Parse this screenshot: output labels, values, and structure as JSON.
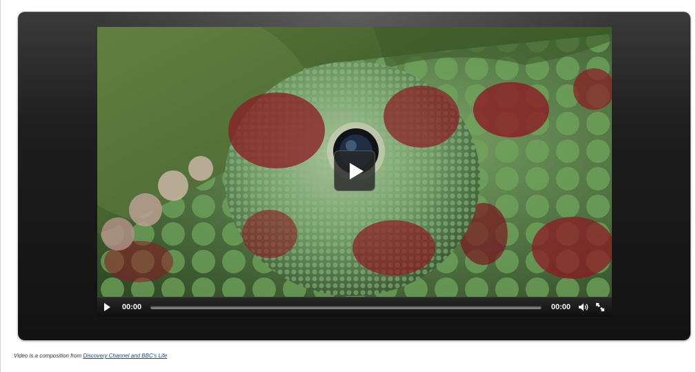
{
  "player": {
    "current_time": "00:00",
    "duration": "00:00",
    "progress": 0,
    "big_play_icon": "play-icon",
    "controls": {
      "play_icon": "play-icon",
      "volume_icon": "volume-icon",
      "fullscreen_icon": "fullscreen-icon"
    }
  },
  "caption": {
    "prefix": "Video is a composition from ",
    "link_text": "Discovery Channel and BBC's Life"
  },
  "colors": {
    "stage_background": "#1e1e1e",
    "controls_background": "#0e0e0e",
    "link": "#1a44b8",
    "chameleon_green": "#5d8f4c",
    "chameleon_red": "#8c1a24"
  }
}
